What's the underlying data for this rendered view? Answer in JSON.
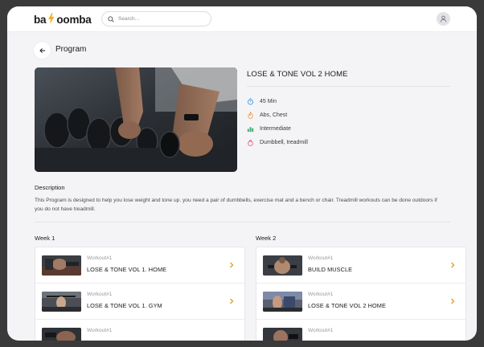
{
  "header": {
    "logo_text_left": "ba",
    "logo_text_right": "oomba",
    "search_placeholder": "Search..."
  },
  "page": {
    "title": "Program"
  },
  "program": {
    "name": "LOSE & TONE VOL 2 HOME",
    "meta": [
      {
        "icon": "stopwatch-icon",
        "text": "45 Min",
        "color": "#3d9be9"
      },
      {
        "icon": "flame-icon",
        "text": "Abs, Chest",
        "color": "#f0913a"
      },
      {
        "icon": "bar-chart-icon",
        "text": "Intermediate",
        "color": "#33a96a"
      },
      {
        "icon": "kettlebell-icon",
        "text": "Dumbbell, treadmill",
        "color": "#e2566a"
      }
    ],
    "description_title": "Description",
    "description": "This Program is designed to help you lose weight and tone up. you need a pair of dumbbells, exercise mat and a bench or chair. Treadmill workouts can be done outdoors if you do not have treadmill."
  },
  "weeks": [
    {
      "title": "Week 1",
      "workouts": [
        {
          "sub": "Workout#1",
          "name": "LOSE & TONE VOL 1. HOME"
        },
        {
          "sub": "Workout#1",
          "name": "LOSE & TONE VOL 1. GYM"
        },
        {
          "sub": "Workout#1",
          "name": ""
        }
      ]
    },
    {
      "title": "Week 2",
      "workouts": [
        {
          "sub": "Workout#1",
          "name": "BUILD MUSCLE"
        },
        {
          "sub": "Workout#1",
          "name": "LOSE & TONE VOL 2 HOME"
        },
        {
          "sub": "Workout#1",
          "name": ""
        }
      ]
    }
  ],
  "colors": {
    "accent": "#f0b429",
    "chevron": "#e0a020",
    "background": "#f4f4f6"
  }
}
